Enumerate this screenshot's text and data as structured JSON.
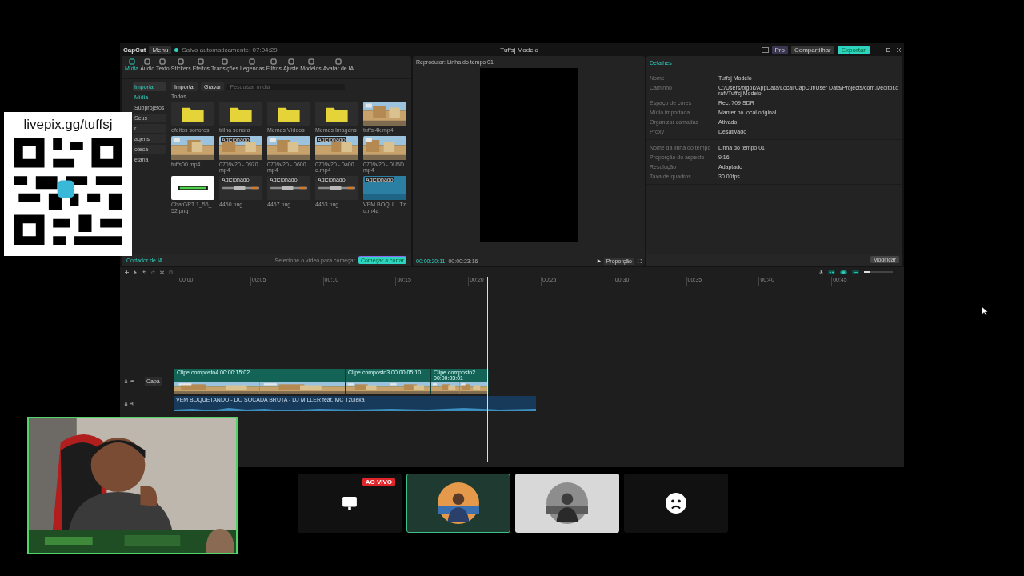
{
  "overlay": {
    "url": "livepix.gg/tuffsj"
  },
  "app": {
    "logo": "CapCut",
    "menu": "Menu",
    "autosave": "Salvo automaticamente: 07:04:29",
    "title": "Tuffsj Modelo",
    "pro": "Pro",
    "share": "Compartilhar",
    "export": "Exportar"
  },
  "toolbar": [
    {
      "label": "Mídia",
      "selected": true
    },
    {
      "label": "Áudio",
      "selected": false
    },
    {
      "label": "Texto",
      "selected": false
    },
    {
      "label": "Stickers",
      "selected": false
    },
    {
      "label": "Efeitos",
      "selected": false
    },
    {
      "label": "Transições",
      "selected": false
    },
    {
      "label": "Legendas",
      "selected": false
    },
    {
      "label": "Filtros",
      "selected": false
    },
    {
      "label": "Ajuste",
      "selected": false
    },
    {
      "label": "Modelos",
      "selected": false
    },
    {
      "label": "Avatar de IA",
      "selected": false
    }
  ],
  "sidebar": [
    {
      "label": "Importar",
      "kind": "dropdown",
      "selected": true
    },
    {
      "label": "Mídia",
      "kind": "link",
      "selected": true
    },
    {
      "label": "Subprojetos",
      "kind": "link",
      "selected": false
    },
    {
      "label": "Seus",
      "kind": "dropdown",
      "selected": false
    },
    {
      "label": "r",
      "kind": "dropdown",
      "selected": false
    },
    {
      "label": "agens",
      "kind": "dropdown",
      "selected": false
    },
    {
      "label": "oteca",
      "kind": "dropdown",
      "selected": false
    },
    {
      "label": "etária",
      "kind": "link",
      "selected": false
    }
  ],
  "media": {
    "import": "Importar",
    "record": "Gravar",
    "search": {
      "placeholder": "Pesquisar mídia"
    },
    "section": "Todos",
    "items": [
      {
        "name": "efeitos sonoros",
        "kind": "folder"
      },
      {
        "name": "trilha sonora",
        "kind": "folder"
      },
      {
        "name": "Memes Vídeos",
        "kind": "folder"
      },
      {
        "name": "Memes Imagens",
        "kind": "folder"
      },
      {
        "name": "tuffsj4k.mp4",
        "kind": "video"
      },
      {
        "name": "tuffs00.mp4",
        "kind": "video"
      },
      {
        "name": "0709v20 - 0970.mp4",
        "kind": "video",
        "badge": "Adicionado"
      },
      {
        "name": "0709v20 - 0600.mp4",
        "kind": "video"
      },
      {
        "name": "0709v20 - 0a00e.mp4",
        "kind": "video",
        "badge": "Adicionado"
      },
      {
        "name": "0709v20 - 0U5D.mp4",
        "kind": "video"
      },
      {
        "name": "ChatGPT 1_56_52.png"
      },
      {
        "name": "4450.png",
        "kind": "strip",
        "badge": "Adicionado"
      },
      {
        "name": "4457.png",
        "kind": "strip",
        "badge": "Adicionado"
      },
      {
        "name": "4463.png",
        "kind": "strip",
        "badge": "Adicionado"
      },
      {
        "name": "VEM BOQU... Tzu.m4a",
        "kind": "audio",
        "badge": "Adicionado"
      }
    ]
  },
  "ai_cutter": {
    "label": "Cortador de IA",
    "hint": "Selecione o vídeo para começar",
    "button": "Começar a cortar"
  },
  "player": {
    "title": "Reprodutor: Linha do tempo 01",
    "current": "00:00:20:11",
    "total": "00:00:23:16",
    "ratio": "Proporção"
  },
  "details": {
    "title": "Detalhes",
    "groups": [
      [
        {
          "label": "Nome",
          "value": "Tuffsj Modelo"
        },
        {
          "label": "Caminho",
          "value": "C:/Users/bigok/AppData/Local/CapCut/User Data/Projects/com.lveditor.draft/Tuffsj Modelo"
        },
        {
          "label": "Espaço de cores",
          "value": "Rec. 709 SDR"
        },
        {
          "label": "Mídia importada",
          "value": "Manter no local original"
        },
        {
          "label": "Organizar camadas",
          "value": "Ativado"
        },
        {
          "label": "Proxy",
          "value": "Desativado"
        }
      ],
      [
        {
          "label": "Nome da linha do tempo",
          "value": "Linha do tempo 01"
        },
        {
          "label": "Proporção do aspecto",
          "value": "9:16"
        },
        {
          "label": "Resolução",
          "value": "Adaptado"
        },
        {
          "label": "Taxa de quadros",
          "value": "30.00fps"
        }
      ]
    ],
    "button": "Modificar"
  },
  "timeline": {
    "zoom": {
      "level": 0.2
    },
    "ticks": [
      "00:00",
      "00:05",
      "00:10",
      "00:15",
      "00:20",
      "00:25",
      "00:30",
      "00:35",
      "00:40",
      "00:45"
    ],
    "cover": "Capa",
    "clips": [
      {
        "name": "Clipe composto4",
        "duration": "00:00:15:02"
      },
      {
        "name": "Clipe composto3",
        "duration": "00:00:05:10"
      },
      {
        "name": "Clipe composto2",
        "duration": "00:00:03:01"
      }
    ],
    "audio": "VEM BOQUETANDO - DO SOCADA BRUTA - DJ MILLER feat. MC Tzuleka"
  },
  "stream": {
    "live": "AO VIVO",
    "cards": [
      {
        "kind": "screen",
        "selected": false
      },
      {
        "kind": "avatar",
        "selected": true
      },
      {
        "kind": "avatar",
        "selected": false
      },
      {
        "kind": "sad",
        "selected": false
      }
    ]
  }
}
